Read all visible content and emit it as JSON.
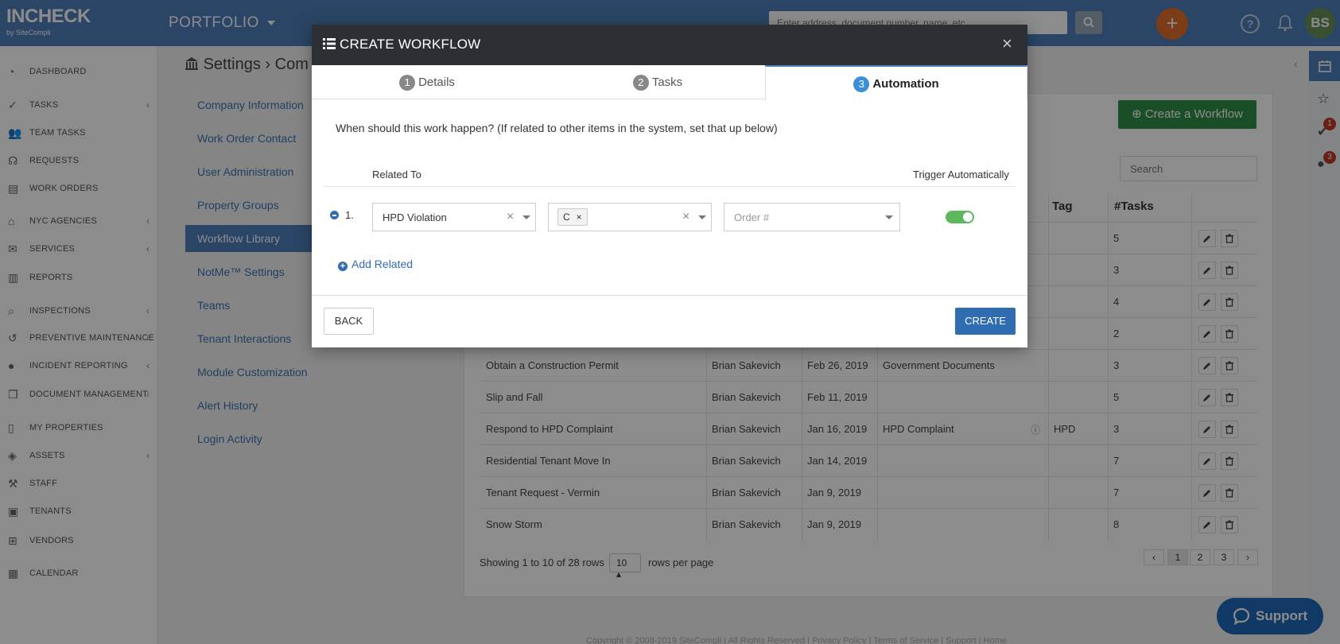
{
  "app": {
    "logo_main": "INCHECK",
    "logo_sub": "by SiteCompli",
    "portfolio_label": "PORTFOLIO",
    "search_placeholder": "Enter address, document number, name, etc.",
    "avatar_initials": "BS"
  },
  "sidebar": {
    "items": [
      {
        "label": "DASHBOARD",
        "icon": "dashboard-icon",
        "chevron": false
      },
      {
        "label": "TASKS",
        "icon": "check-circle-icon",
        "chevron": true
      },
      {
        "label": "TEAM TASKS",
        "icon": "users-icon",
        "chevron": false
      },
      {
        "label": "REQUESTS",
        "icon": "headset-icon",
        "chevron": false
      },
      {
        "label": "WORK ORDERS",
        "icon": "clipboard-icon",
        "chevron": false
      },
      {
        "label": "NYC AGENCIES",
        "icon": "bank-icon",
        "chevron": true
      },
      {
        "label": "SERVICES",
        "icon": "envelope-icon",
        "chevron": true
      },
      {
        "label": "REPORTS",
        "icon": "bar-chart-icon",
        "chevron": false
      },
      {
        "label": "INSPECTIONS",
        "icon": "search-icon",
        "chevron": true
      },
      {
        "label": "PREVENTIVE MAINTENANCE",
        "icon": "history-icon",
        "chevron": true
      },
      {
        "label": "INCIDENT REPORTING",
        "icon": "alert-icon",
        "chevron": true
      },
      {
        "label": "DOCUMENT MANAGEMENT",
        "icon": "documents-icon",
        "chevron": true
      },
      {
        "label": "MY PROPERTIES",
        "icon": "building-icon",
        "chevron": false
      },
      {
        "label": "ASSETS",
        "icon": "layers-icon",
        "chevron": true
      },
      {
        "label": "STAFF",
        "icon": "tools-icon",
        "chevron": false
      },
      {
        "label": "TENANTS",
        "icon": "tenant-icon",
        "chevron": false
      },
      {
        "label": "VENDORS",
        "icon": "sitemap-icon",
        "chevron": false
      },
      {
        "label": "CALENDAR",
        "icon": "calendar-icon",
        "chevron": false
      }
    ]
  },
  "page": {
    "title_part1": "Settings",
    "title_sep": "›",
    "title_part2": "Com",
    "nav": [
      {
        "label": "Company Information",
        "active": false
      },
      {
        "label": "Work Order Contact",
        "active": false
      },
      {
        "label": "User Administration",
        "active": false
      },
      {
        "label": "Property Groups",
        "active": false
      },
      {
        "label": "Workflow Library",
        "active": true
      },
      {
        "label": "NotMe™ Settings",
        "active": false
      },
      {
        "label": "Teams",
        "active": false
      },
      {
        "label": "Tenant Interactions",
        "active": false
      },
      {
        "label": "Module Customization",
        "active": false
      },
      {
        "label": "Alert History",
        "active": false
      },
      {
        "label": "Login Activity",
        "active": false
      }
    ],
    "create_workflow_label": "Create a Workflow",
    "panel_search_placeholder": "Search"
  },
  "table": {
    "headers": {
      "tag": "Tag",
      "tasks": "#Tasks"
    },
    "rows": [
      {
        "name": "",
        "creator": "",
        "date": "",
        "category": "",
        "tag": "",
        "tasks": "5"
      },
      {
        "name": "",
        "creator": "",
        "date": "",
        "category": "",
        "tag": "",
        "tasks": "3"
      },
      {
        "name": "",
        "creator": "",
        "date": "",
        "category": "",
        "tag": "",
        "tasks": "4"
      },
      {
        "name": "",
        "creator": "",
        "date": "",
        "category": "",
        "tag": "",
        "tasks": "2"
      },
      {
        "name": "Obtain a Construction Permit",
        "creator": "Brian Sakevich",
        "date": "Feb 26, 2019",
        "category": "Government Documents",
        "tag": "",
        "tasks": "3"
      },
      {
        "name": "Slip and Fall",
        "creator": "Brian Sakevich",
        "date": "Feb 11, 2019",
        "category": "",
        "tag": "",
        "tasks": "5"
      },
      {
        "name": "Respond to HPD Complaint",
        "creator": "Brian Sakevich",
        "date": "Jan 16, 2019",
        "category": "HPD Complaint",
        "tag": "HPD",
        "tasks": "3"
      },
      {
        "name": "Residential Tenant Move In",
        "creator": "Brian Sakevich",
        "date": "Jan 14, 2019",
        "category": "",
        "tag": "",
        "tasks": "7"
      },
      {
        "name": "Tenant Request - Vermin",
        "creator": "Brian Sakevich",
        "date": "Jan 9, 2019",
        "category": "",
        "tag": "",
        "tasks": "7"
      },
      {
        "name": "Snow Storm",
        "creator": "Brian Sakevich",
        "date": "Jan 9, 2019",
        "category": "",
        "tag": "",
        "tasks": "8"
      }
    ],
    "pagination_text": "Showing 1 to 10 of 28 rows",
    "rows_per_page_value": "10",
    "rows_per_page_label": "rows per page",
    "pages": [
      "‹",
      "1",
      "2",
      "3",
      "›"
    ],
    "active_page": "1"
  },
  "footer": {
    "text": "Copyright © 2008-2019 SiteCompli | All Rights Reserved | Privacy Policy | Terms of Service | Support | Home"
  },
  "rail": {
    "badge1": "1",
    "badge2": "3"
  },
  "support": {
    "label": "Support"
  },
  "modal": {
    "title": "CREATE WORKFLOW",
    "tabs": [
      {
        "num": "1",
        "label": "Details"
      },
      {
        "num": "2",
        "label": "Tasks"
      },
      {
        "num": "3",
        "label": "Automation"
      }
    ],
    "question": "When should this work happen? (If related to other items in the system, set that up below)",
    "col_related": "Related To",
    "col_trigger": "Trigger Automatically",
    "row_number": "1.",
    "related_value": "HPD Violation",
    "class_tag": "C",
    "order_placeholder": "Order #",
    "add_related_label": "Add Related",
    "back_label": "BACK",
    "create_label": "CREATE",
    "trigger_on": true
  },
  "colors": {
    "brand": "#4d7fb8",
    "header_dark": "#2c3035",
    "primary": "#2f6db0",
    "success": "#2f8f46"
  }
}
